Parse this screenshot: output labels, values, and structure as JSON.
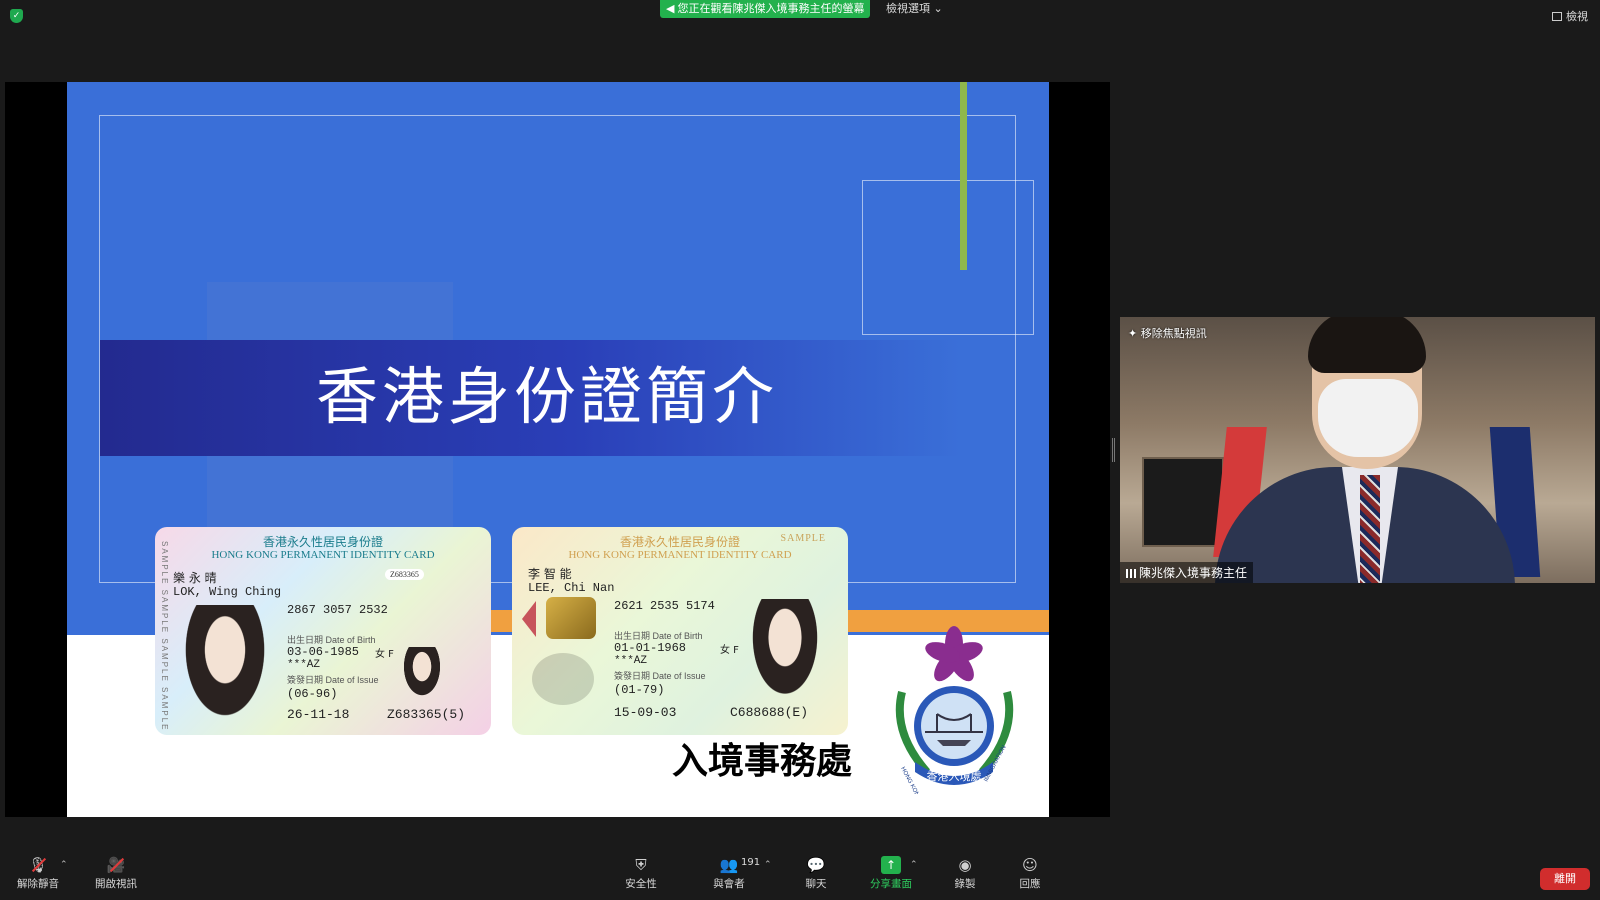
{
  "topbar": {
    "viewing_banner": "您正在觀看陳兆傑入境事務主任的螢幕",
    "view_options": "檢視選項",
    "view_button": "檢視"
  },
  "slide": {
    "title": "香港身份證簡介",
    "department": "入境事務處",
    "emblem_text": "香港入境處",
    "emblem_text_left": "HONG KONG",
    "emblem_text_right": "IMMIGRATION"
  },
  "card1": {
    "header_cn": "香港永久性居民身份證",
    "header_en": "HONG KONG PERMANENT IDENTITY CARD",
    "side_sample": "SAMPLE SAMPLE SAMPLE SAMPLE",
    "serial_badge": "Z683365",
    "name_cn": "樂 永 晴",
    "name_en": "LOK, Wing Ching",
    "ccc": "2867 3057 2532",
    "dob_label": "出生日期 Date of Birth",
    "dob": "03-06-1985",
    "sex": "女 F",
    "symbols": "***AZ",
    "doi_label": "簽發日期 Date of Issue",
    "first_issue": "(06-96)",
    "issue_date": "26-11-18",
    "id_number": "Z683365(5)"
  },
  "card2": {
    "header_cn": "香港永久性居民身份證",
    "header_en": "HONG KONG PERMANENT IDENTITY CARD",
    "sample_tag": "SAMPLE",
    "name_cn": "李 智 能",
    "name_en": "LEE, Chi Nan",
    "ccc": "2621 2535 5174",
    "dob_label": "出生日期 Date of Birth",
    "dob": "01-01-1968",
    "sex": "女 F",
    "symbols": "***AZ",
    "doi_label": "簽發日期 Date of Issue",
    "first_issue": "(01-79)",
    "issue_date": "15-09-03",
    "id_number": "C688688(E)"
  },
  "video": {
    "focus_label": "移除焦點視訊",
    "participant_name": "陳兆傑入境事務主任"
  },
  "toolbar": {
    "unmute": "解除靜音",
    "start_video": "開啟視訊",
    "security": "安全性",
    "participants": "與會者",
    "participant_count": "191",
    "chat": "聊天",
    "share_screen": "分享畫面",
    "record": "錄製",
    "reactions": "回應",
    "leave": "離開"
  },
  "colors": {
    "slide_blue": "#3a6fd8",
    "zoom_green": "#23b14d",
    "leave_red": "#d12d2d"
  }
}
